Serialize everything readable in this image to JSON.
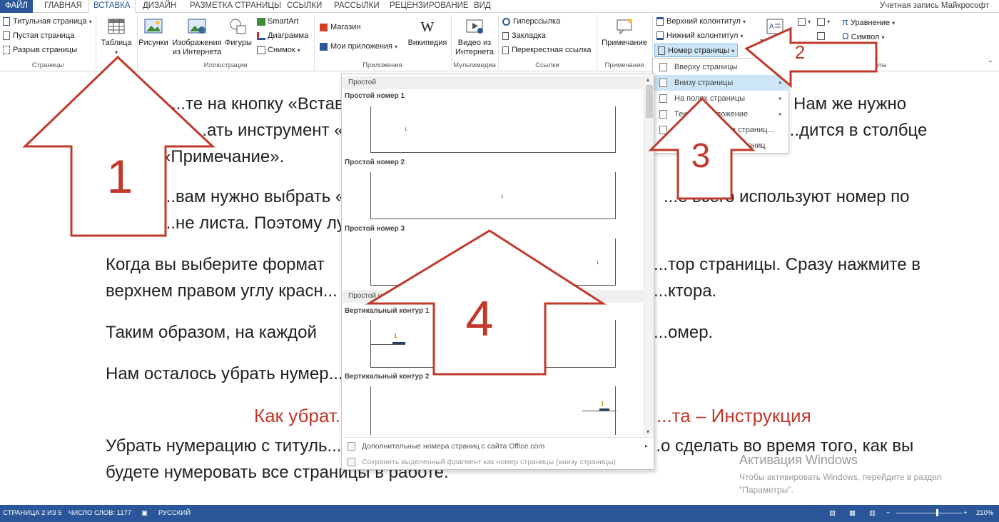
{
  "tabs": [
    "ФАЙЛ",
    "ГЛАВНАЯ",
    "ВСТАВКА",
    "ДИЗАЙН",
    "РАЗМЕТКА СТРАНИЦЫ",
    "ССЫЛКИ",
    "РАССЫЛКИ",
    "РЕЦЕНЗИРОВАНИЕ",
    "ВИД"
  ],
  "account": "Учетная запись Майкрософт",
  "ribbon": {
    "pages": {
      "title_page": "Титульная страница",
      "blank_page": "Пустая страница",
      "page_break": "Разрыв страницы",
      "label": "Страницы"
    },
    "table": {
      "label": "Таблица",
      "group": "Та..."
    },
    "illustrations": {
      "pictures": "Рисунки",
      "online_pictures_1": "Изображения",
      "online_pictures_2": "из Интернета",
      "shapes": "Фигуры",
      "smartart": "SmartArt",
      "chart": "Диаграмма",
      "screenshot": "Снимок",
      "label": "Иллюстрации"
    },
    "apps": {
      "store": "Магазин",
      "my_apps": "Мои приложения",
      "wikipedia": "Википедия",
      "label": "Приложения"
    },
    "media": {
      "video_1": "Видео из",
      "video_2": "Интернета",
      "label": "Мультимедиа"
    },
    "links": {
      "hyperlink": "Гиперссылка",
      "bookmark": "Закладка",
      "crossref": "Перекрестная ссылка",
      "label": "Ссылки"
    },
    "comments": {
      "comment": "Примечание",
      "label": "Примечания"
    },
    "header_footer": {
      "header": "Верхний колонтитул",
      "footer": "Нижний колонтитул",
      "page_number": "Номер страницы"
    },
    "text": {
      "textbox": "Тексто..."
    },
    "symbols": {
      "equation": "Уравнение",
      "symbol": "Символ",
      "label": "Символы"
    }
  },
  "menu_page_number": {
    "items": [
      {
        "label": "Вверху страницы",
        "arrow": true
      },
      {
        "label": "Внизу страницы",
        "arrow": true
      },
      {
        "label": "На полях страницы",
        "arrow": true
      },
      {
        "label": "Текущее положение",
        "arrow": true
      },
      {
        "label": "Формат номеров страниц...",
        "arrow": false
      },
      {
        "label": "Удалить номера страниц",
        "arrow": false
      }
    ]
  },
  "gallery": {
    "section1": "Простой",
    "section2": "Простой н...",
    "items": [
      {
        "title": "Простой номер 1",
        "num": "1"
      },
      {
        "title": "Простой номер 2",
        "num": "1"
      },
      {
        "title": "Простой номер 3",
        "num": "1"
      },
      {
        "title": "Вертикальный контур 1",
        "num": "1"
      },
      {
        "title": "Вертикальный контур 2",
        "num": "1"
      }
    ],
    "more": "Дополнительные номера страниц с сайта Office.com",
    "save": "Сохранить выделенный фрагмент как номер страницы (внизу страницы)"
  },
  "document": {
    "l1a": "...те на кнопку «Вставк...",
    "l1b": "Нам же нужно",
    "l2a": "...ать инструмент «",
    "l2b": "...дится в столбце",
    "l3": "«Примечание».",
    "l4a": "...вам нужно выбрать «",
    "l4b": "...е всего используют номер по",
    "l5a": "...не листа. Поэтому лу...",
    "l6a": "Когда вы выберите формат",
    "l6b": "...тор страницы. Сразу нажмите в",
    "l7a": "верхнем правом углу красн...",
    "l7b": "...ктора.",
    "l8a": "Таким образом, на каждой",
    "l8b": "...омер.",
    "l9a": "Нам осталось убрать нумер...",
    "heading_a": "Как убрат...",
    "heading_b": "...та – Инструкция",
    "l10a": "Убрать нумерацию с титуль...",
    "l10b": "...о сделать во время того, как вы",
    "l11": "будете нумеровать все страницы в работе."
  },
  "watermark": {
    "title": "Активация Windows",
    "line1": "Чтобы активировать Windows, перейдите в раздел",
    "line2": "\"Параметры\"."
  },
  "status": {
    "page": "СТРАНИЦА 2 ИЗ 5",
    "words": "ЧИСЛО СЛОВ: 1177",
    "lang": "РУССКИЙ",
    "zoom": "210%"
  },
  "annotations": {
    "a1": "1",
    "a2": "2",
    "a3": "3",
    "a4": "4"
  },
  "colors": {
    "accent": "#2b579a",
    "arrow": "#c0392b",
    "highlight": "#cde6f7"
  }
}
